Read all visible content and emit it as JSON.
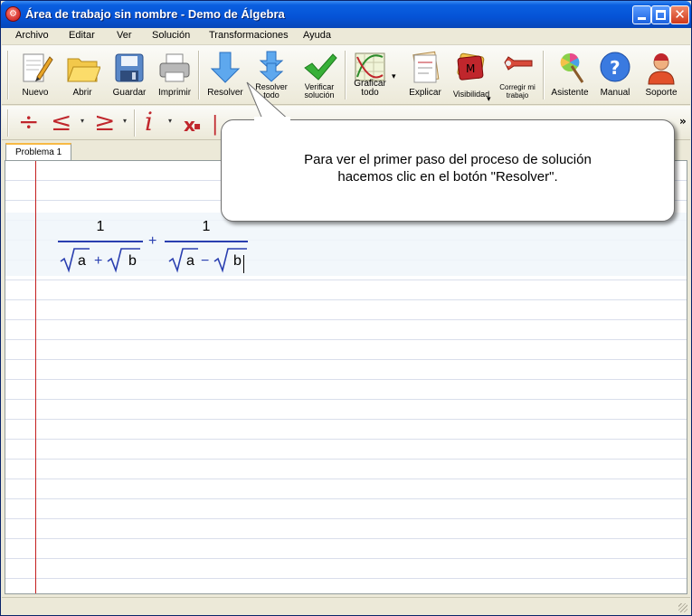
{
  "window": {
    "title": "Área de trabajo sin nombre - Demo de Álgebra",
    "close_glyph": "✕"
  },
  "menu": [
    "Archivo",
    "Editar",
    "Ver",
    "Solución",
    "Transformaciones",
    "Ayuda"
  ],
  "toolbar": {
    "new": "Nuevo",
    "open": "Abrir",
    "save": "Guardar",
    "print": "Imprimir",
    "solve": "Resolver",
    "solve_all": "Resolver todo",
    "verify": "Verificar solución",
    "graph_all": "Graficar todo",
    "explain": "Explicar",
    "visibility": "Visibilidad",
    "fix": "Corregir mi trabajo",
    "assistant": "Asistente",
    "manual": "Manual",
    "support": "Soporte"
  },
  "math_toolbar": {
    "divide": "÷",
    "le": "≤",
    "ge": "≥",
    "imag": "i",
    "subscript": "x",
    "more": "»"
  },
  "tabs": [
    "Problema 1"
  ],
  "expression": {
    "frac1_num": "1",
    "frac1_den_a": "a",
    "frac1_op": "+",
    "frac1_den_b": "b",
    "middle_op": "+",
    "frac2_num": "1",
    "frac2_den_a": "a",
    "frac2_op": "−",
    "frac2_den_b": "b"
  },
  "callout": {
    "line1": "Para ver el primer paso del proceso de solución",
    "line2": "hacemos clic en el botón \"Resolver\"."
  },
  "colors": {
    "accent_red": "#c0262c",
    "math_blue": "#2a3fb0",
    "margin_red": "#c41e1e"
  }
}
